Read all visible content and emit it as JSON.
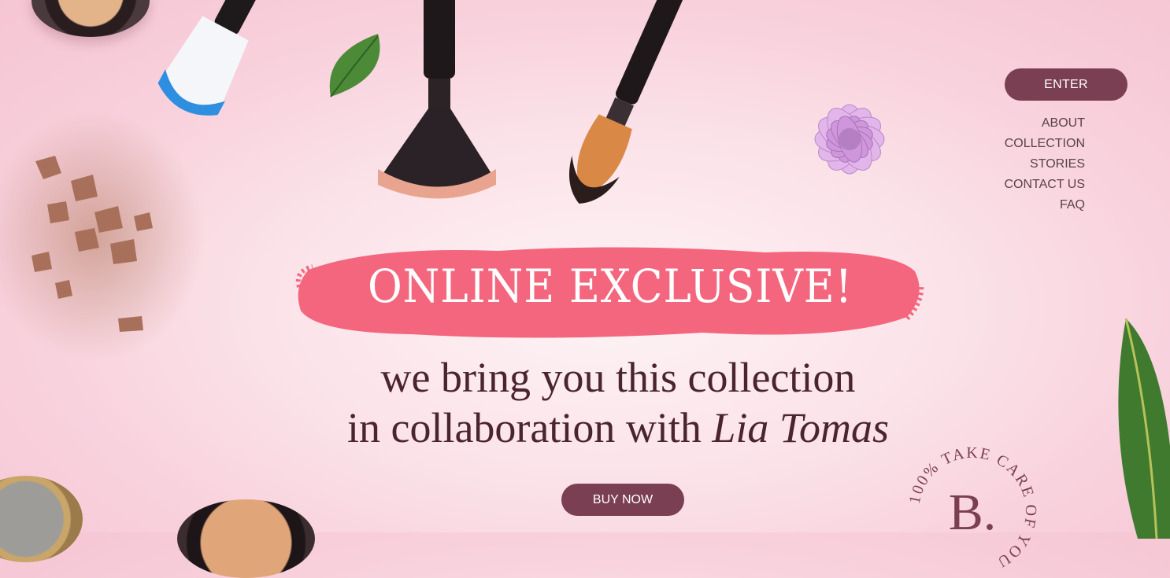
{
  "nav": {
    "enter_label": "ENTER",
    "links": [
      "ABOUT",
      "COLLECTION",
      "STORIES",
      "CONTACT US",
      "FAQ"
    ]
  },
  "hero": {
    "headline": "ONLINE EXCLUSIVE!",
    "line1": "we bring you this collection",
    "line2_prefix": "in collaboration with",
    "line2_name": "Lia Tomas",
    "buy_label": "BUY NOW"
  },
  "badge": {
    "monogram": "B.",
    "ring_text": "100% TAKE CARE OF YOU"
  },
  "colors": {
    "accent": "#7a3f52",
    "brush_stroke": "#f4667e",
    "text_dark": "#4a2430"
  },
  "icons": [
    "compact-icon",
    "blush-brush-icon",
    "leaf-icon",
    "fan-brush-icon",
    "contour-brush-icon",
    "dahlia-flower-icon",
    "powder-icon"
  ]
}
